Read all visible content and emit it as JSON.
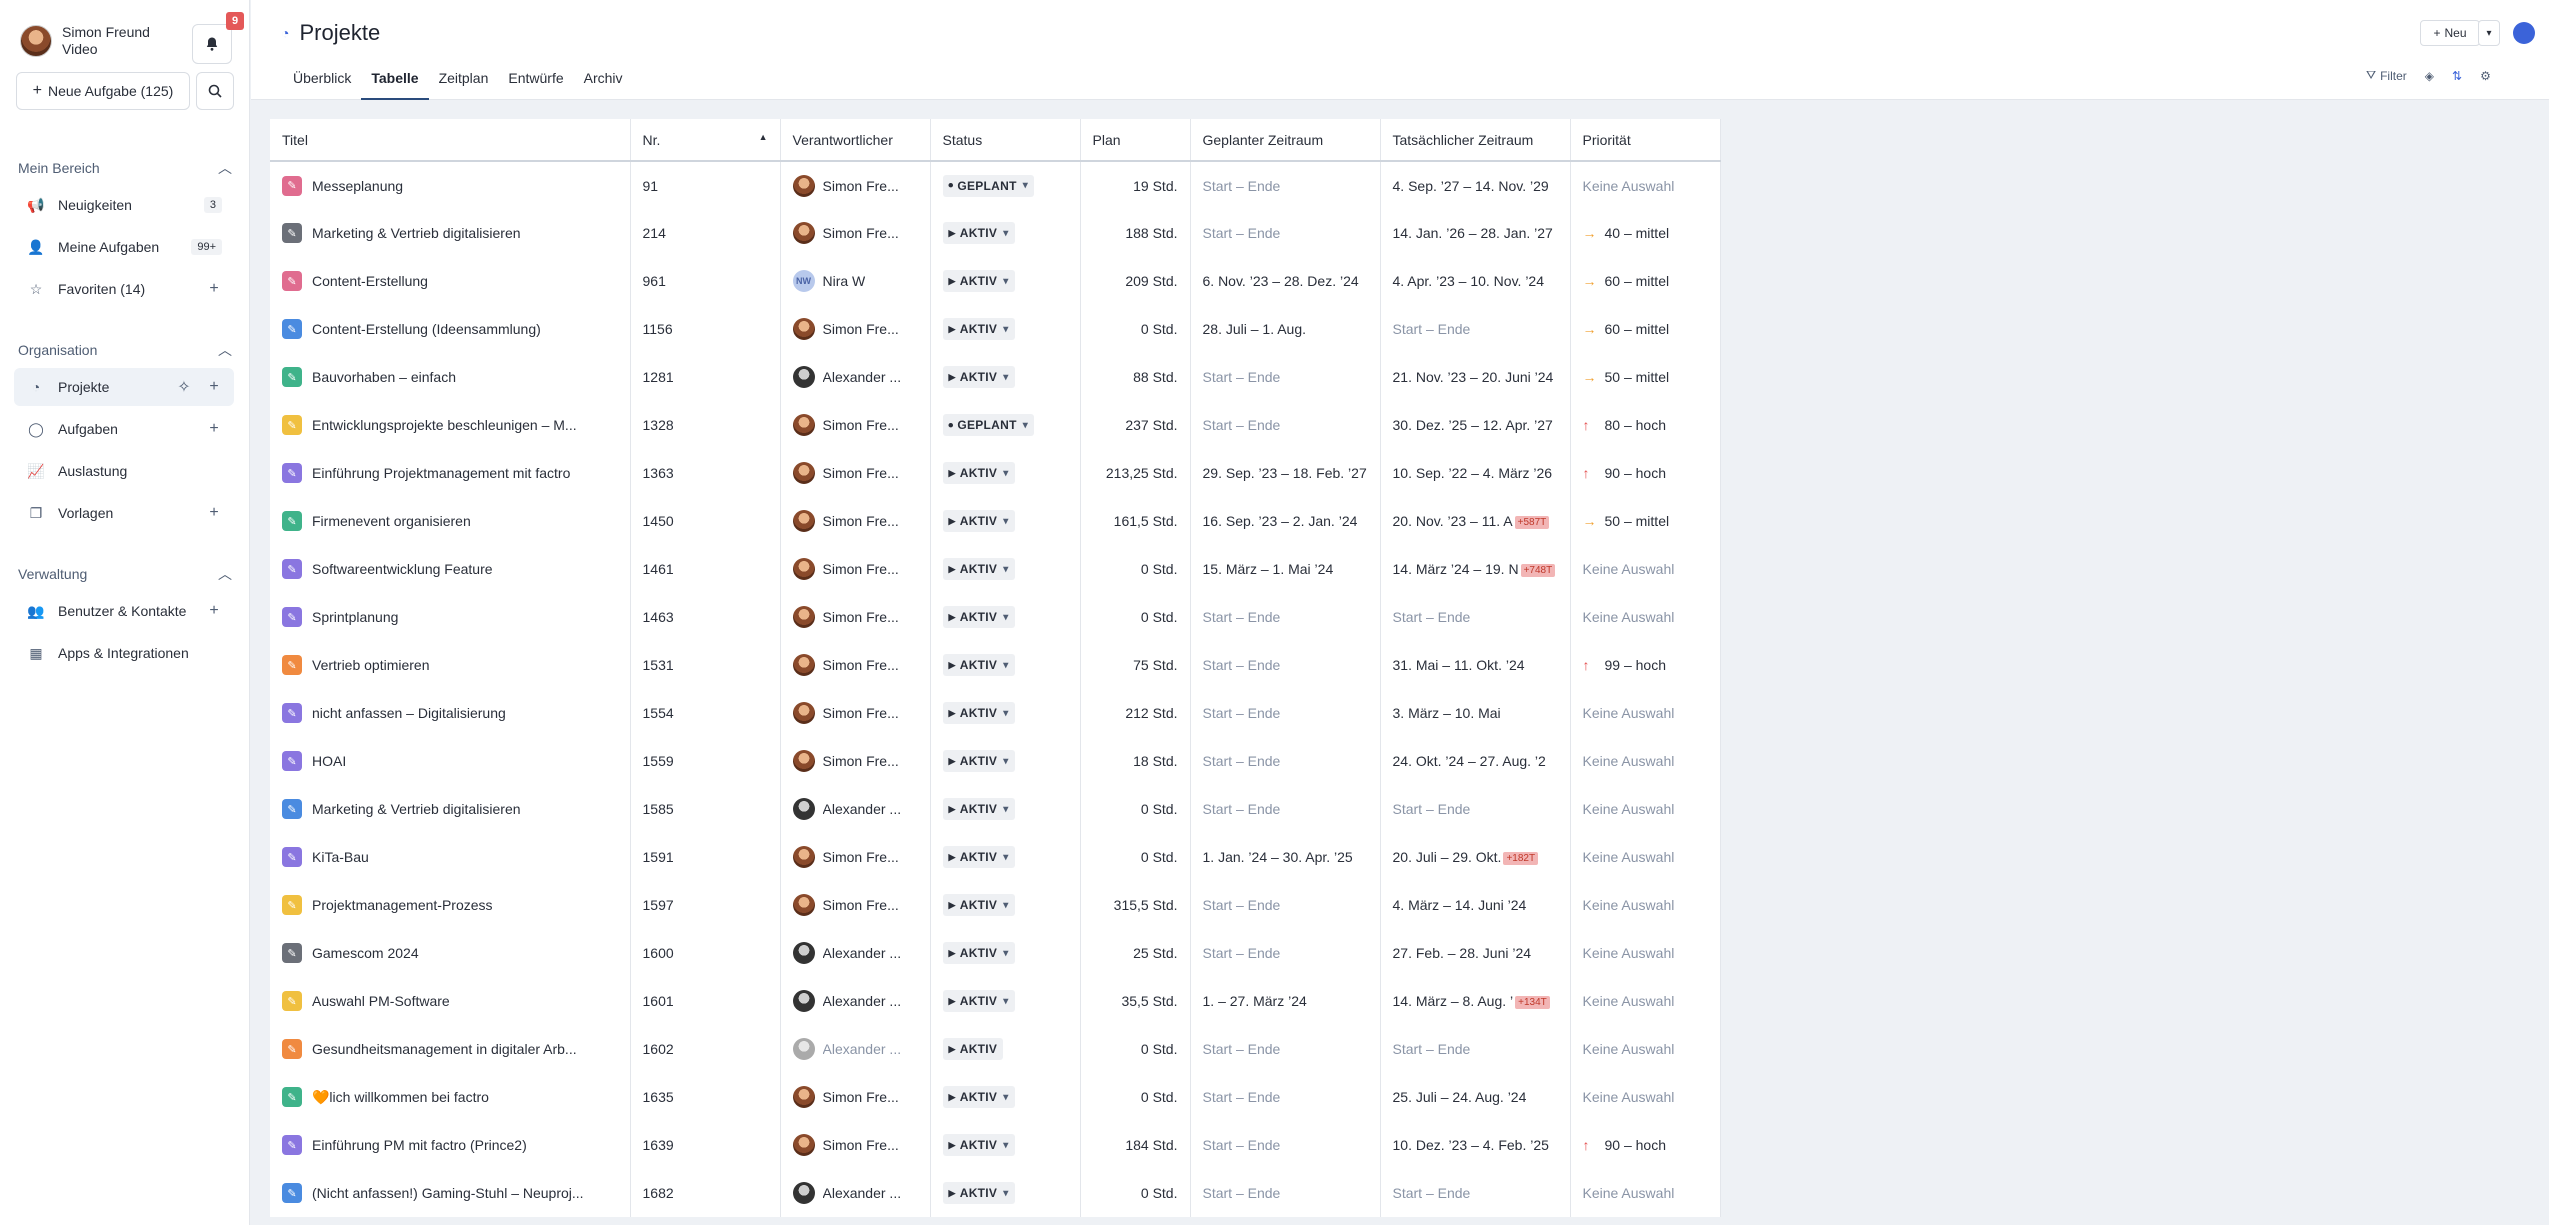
{
  "user": {
    "name": "Simon Freund",
    "role": "Video"
  },
  "notifications": {
    "count": "9"
  },
  "sidebar": {
    "new_task_label": "Neue Aufgabe (125)",
    "section_mine": "Mein Bereich",
    "section_org": "Organisation",
    "section_admin": "Verwaltung",
    "mine_items": [
      {
        "label": "Neuigkeiten",
        "count": "3"
      },
      {
        "label": "Meine Aufgaben",
        "count": "99+"
      },
      {
        "label": "Favoriten (14)"
      }
    ],
    "org_items": [
      {
        "label": "Projekte"
      },
      {
        "label": "Aufgaben"
      },
      {
        "label": "Auslastung"
      },
      {
        "label": "Vorlagen"
      }
    ],
    "admin_items": [
      {
        "label": "Benutzer & Kontakte"
      },
      {
        "label": "Apps & Integrationen"
      }
    ]
  },
  "header": {
    "title": "Projekte",
    "new_label": "Neu",
    "filter_label": "Filter",
    "tabs": [
      {
        "label": "Überblick"
      },
      {
        "label": "Tabelle"
      },
      {
        "label": "Zeitplan"
      },
      {
        "label": "Entwürfe"
      },
      {
        "label": "Archiv"
      }
    ]
  },
  "table": {
    "columns": [
      "Titel",
      "Nr.",
      "Verantwortlicher",
      "Status",
      "Plan",
      "Geplanter Zeitraum",
      "Tatsächlicher Zeitraum",
      "Priorität"
    ],
    "rows": [
      {
        "color": "#e06c8f",
        "title": "Messeplanung",
        "nr": "91",
        "owner": "Simon Fre...",
        "av": "simon",
        "status": "GEPLANT",
        "plan": "19 Std.",
        "planned": "Start – Ende",
        "actual": "4. Sep. ’27 – 14. Nov. ’29",
        "over": "",
        "prio": "Keine Auswahl",
        "plevel": "none"
      },
      {
        "color": "#6b6f78",
        "title": "Marketing & Vertrieb digitalisieren",
        "nr": "214",
        "owner": "Simon Fre...",
        "av": "simon",
        "status": "AKTIV",
        "plan": "188 Std.",
        "planned": "Start – Ende",
        "actual": "14. Jan. ’26 – 28. Jan. ’27",
        "over": "",
        "prio": "40 – mittel",
        "plevel": "mid"
      },
      {
        "color": "#e06c8f",
        "title": "Content-Erstellung",
        "nr": "961",
        "owner": "Nira W",
        "av": "nw",
        "status": "AKTIV",
        "plan": "209 Std.",
        "planned": "6. Nov. ’23 – 28. Dez. ’24",
        "actual": "4. Apr. ’23 – 10. Nov. ’24",
        "over": "",
        "prio": "60 – mittel",
        "plevel": "mid"
      },
      {
        "color": "#4a8be0",
        "title": "Content-Erstellung (Ideensammlung)",
        "nr": "1156",
        "owner": "Simon Fre...",
        "av": "simon",
        "status": "AKTIV",
        "plan": "0 Std.",
        "planned": "28. Juli – 1. Aug.",
        "actual": "Start – Ende",
        "over": "",
        "prio": "60 – mittel",
        "plevel": "mid"
      },
      {
        "color": "#3fb38a",
        "title": "Bauvorhaben – einfach",
        "nr": "1281",
        "owner": "Alexander ...",
        "av": "alex",
        "status": "AKTIV",
        "plan": "88 Std.",
        "planned": "Start – Ende",
        "actual": "21. Nov. ’23 – 20. Juni ’24",
        "over": "",
        "prio": "50 – mittel",
        "plevel": "mid"
      },
      {
        "color": "#f0c040",
        "title": "Entwicklungsprojekte beschleunigen – M...",
        "nr": "1328",
        "owner": "Simon Fre...",
        "av": "simon",
        "status": "GEPLANT",
        "plan": "237 Std.",
        "planned": "Start – Ende",
        "actual": "30. Dez. ’25 – 12. Apr. ’27",
        "over": "",
        "prio": "80 – hoch",
        "plevel": "high"
      },
      {
        "color": "#8a76e0",
        "title": "Einführung Projektmanagement mit factro",
        "nr": "1363",
        "owner": "Simon Fre...",
        "av": "simon",
        "status": "AKTIV",
        "plan": "213,25 Std.",
        "planned": "29. Sep. ’23 – 18. Feb. ’27",
        "actual": "10. Sep. ’22 – 4. März ’26",
        "over": "",
        "prio": "90 – hoch",
        "plevel": "high"
      },
      {
        "color": "#3fb38a",
        "title": "Firmenevent organisieren",
        "nr": "1450",
        "owner": "Simon Fre...",
        "av": "simon",
        "status": "AKTIV",
        "plan": "161,5 Std.",
        "planned": "16. Sep. ’23 – 2. Jan. ’24",
        "actual": "20. Nov. ’23 – 11. A",
        "over": "+587T",
        "prio": "50 – mittel",
        "plevel": "mid"
      },
      {
        "color": "#8a76e0",
        "title": "Softwareentwicklung Feature",
        "nr": "1461",
        "owner": "Simon Fre...",
        "av": "simon",
        "status": "AKTIV",
        "plan": "0 Std.",
        "planned": "15. März – 1. Mai ’24",
        "actual": "14. März ’24 – 19. N",
        "over": "+748T",
        "prio": "Keine Auswahl",
        "plevel": "none"
      },
      {
        "color": "#8a76e0",
        "title": "Sprintplanung",
        "nr": "1463",
        "owner": "Simon Fre...",
        "av": "simon",
        "status": "AKTIV",
        "plan": "0 Std.",
        "planned": "Start – Ende",
        "actual": "Start – Ende",
        "over": "",
        "prio": "Keine Auswahl",
        "plevel": "none"
      },
      {
        "color": "#f08a40",
        "title": "Vertrieb optimieren",
        "nr": "1531",
        "owner": "Simon Fre...",
        "av": "simon",
        "status": "AKTIV",
        "plan": "75 Std.",
        "planned": "Start – Ende",
        "actual": "31. Mai – 11. Okt. ’24",
        "over": "",
        "prio": "99 – hoch",
        "plevel": "high"
      },
      {
        "color": "#8a76e0",
        "title": "nicht anfassen – Digitalisierung",
        "nr": "1554",
        "owner": "Simon Fre...",
        "av": "simon",
        "status": "AKTIV",
        "plan": "212 Std.",
        "planned": "Start – Ende",
        "actual": "3. März – 10. Mai",
        "over": "",
        "prio": "Keine Auswahl",
        "plevel": "none"
      },
      {
        "color": "#8a76e0",
        "title": "HOAI",
        "nr": "1559",
        "owner": "Simon Fre...",
        "av": "simon",
        "status": "AKTIV",
        "plan": "18 Std.",
        "planned": "Start – Ende",
        "actual": "24. Okt. ’24 – 27. Aug. ’2",
        "over": "",
        "prio": "Keine Auswahl",
        "plevel": "none"
      },
      {
        "color": "#4a8be0",
        "title": "Marketing & Vertrieb digitalisieren",
        "nr": "1585",
        "owner": "Alexander ...",
        "av": "alex",
        "status": "AKTIV",
        "plan": "0 Std.",
        "planned": "Start – Ende",
        "actual": "Start – Ende",
        "over": "",
        "prio": "Keine Auswahl",
        "plevel": "none"
      },
      {
        "color": "#8a76e0",
        "title": "KiTa-Bau",
        "nr": "1591",
        "owner": "Simon Fre...",
        "av": "simon",
        "status": "AKTIV",
        "plan": "0 Std.",
        "planned": "1. Jan. ’24 – 30. Apr. ’25",
        "actual": "20. Juli – 29. Okt.",
        "over": "+182T",
        "prio": "Keine Auswahl",
        "plevel": "none"
      },
      {
        "color": "#f0c040",
        "title": "Projektmanagement-Prozess",
        "nr": "1597",
        "owner": "Simon Fre...",
        "av": "simon",
        "status": "AKTIV",
        "plan": "315,5 Std.",
        "planned": "Start – Ende",
        "actual": "4. März – 14. Juni ’24",
        "over": "",
        "prio": "Keine Auswahl",
        "plevel": "none"
      },
      {
        "color": "#6b6f78",
        "title": "Gamescom 2024",
        "nr": "1600",
        "owner": "Alexander ...",
        "av": "alex",
        "status": "AKTIV",
        "plan": "25 Std.",
        "planned": "Start – Ende",
        "actual": "27. Feb. – 28. Juni ’24",
        "over": "",
        "prio": "Keine Auswahl",
        "plevel": "none"
      },
      {
        "color": "#f0c040",
        "title": "Auswahl PM-Software",
        "nr": "1601",
        "owner": "Alexander ...",
        "av": "alex",
        "status": "AKTIV",
        "plan": "35,5 Std.",
        "planned": "1. – 27. März ’24",
        "actual": "14. März – 8. Aug. ’",
        "over": "+134T",
        "prio": "Keine Auswahl",
        "plevel": "none"
      },
      {
        "color": "#f08a40",
        "title": "Gesundheitsmanagement in digitaler Arb...",
        "nr": "1602",
        "owner": "Alexander ...",
        "av": "alexgrey",
        "status": "AKTIV",
        "plan": "0 Std.",
        "planned": "Start – Ende",
        "actual": "Start – Ende",
        "over": "",
        "prio": "Keine Auswahl",
        "plevel": "none"
      },
      {
        "color": "#3fb38a",
        "title": "🧡lich willkommen bei factro",
        "nr": "1635",
        "owner": "Simon Fre...",
        "av": "simon",
        "status": "AKTIV",
        "plan": "0 Std.",
        "planned": "Start – Ende",
        "actual": "25. Juli – 24. Aug. ’24",
        "over": "",
        "prio": "Keine Auswahl",
        "plevel": "none"
      },
      {
        "color": "#8a76e0",
        "title": "Einführung PM mit factro (Prince2)",
        "nr": "1639",
        "owner": "Simon Fre...",
        "av": "simon",
        "status": "AKTIV",
        "plan": "184 Std.",
        "planned": "Start – Ende",
        "actual": "10. Dez. ’23 – 4. Feb. ’25",
        "over": "",
        "prio": "90 – hoch",
        "plevel": "high"
      },
      {
        "color": "#4a8be0",
        "title": "(Nicht anfassen!) Gaming-Stuhl – Neuproj...",
        "nr": "1682",
        "owner": "Alexander ...",
        "av": "alex",
        "status": "AKTIV",
        "plan": "0 Std.",
        "planned": "Start – Ende",
        "actual": "Start – Ende",
        "over": "",
        "prio": "Keine Auswahl",
        "plevel": "none"
      }
    ]
  }
}
